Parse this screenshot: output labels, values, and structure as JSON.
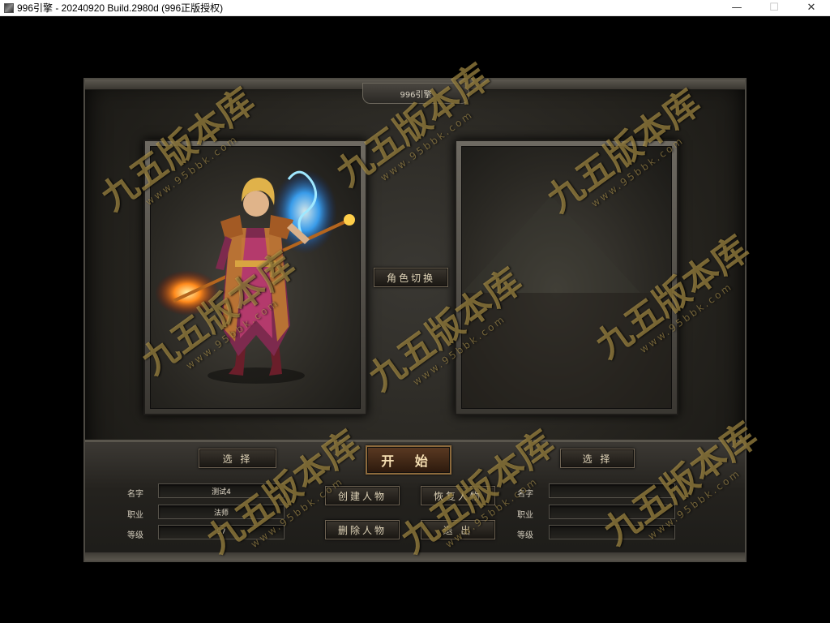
{
  "window": {
    "title": "996引擎 - 20240920 Build.2980d (996正版授权)",
    "minimize_glyph": "—",
    "maximize_glyph": "☐",
    "close_glyph": "✕"
  },
  "frame": {
    "title": "996引擎"
  },
  "panels": {
    "role_switch_label": "角色切换"
  },
  "left_slot": {
    "select_label": "选 择",
    "name_label": "名字",
    "class_label": "职业",
    "level_label": "等级",
    "name_value": "测试4",
    "class_value": "法师",
    "level_value": "97"
  },
  "right_slot": {
    "select_label": "选 择",
    "name_label": "名字",
    "class_label": "职业",
    "level_label": "等级",
    "name_value": "",
    "class_value": "",
    "level_value": ""
  },
  "actions": {
    "start_label": "开 始",
    "create_label": "创建人物",
    "restore_label": "恢复人物",
    "delete_label": "删除人物",
    "exit_label": "退 出"
  },
  "watermark": {
    "text": "九五版本库",
    "url": "www.95bbk.com"
  },
  "colors": {
    "accent_gold": "#d4b258",
    "panel_frame": "#4d4a43",
    "button_text": "#e0d4b8"
  }
}
